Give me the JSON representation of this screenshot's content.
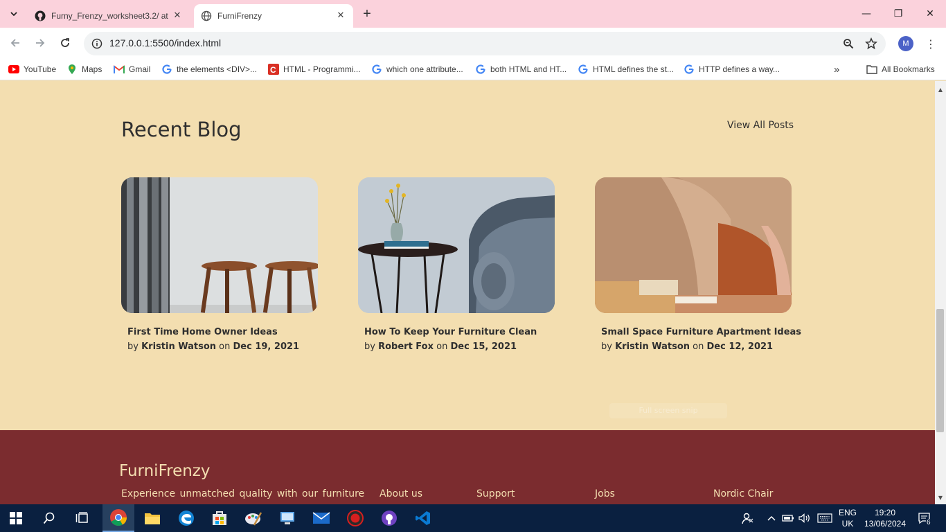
{
  "browser": {
    "tabs": [
      {
        "title": "Furny_Frenzy_worksheet3.2/ at",
        "close": "✕",
        "favicon": "github-icon"
      },
      {
        "title": "FurniFrenzy",
        "close": "✕",
        "favicon": "globe-icon"
      }
    ],
    "new_tab": "+",
    "window": {
      "minimize": "—",
      "restore": "❐",
      "close": "✕"
    },
    "url": "127.0.0.1:5500/index.html",
    "profile_initial": "M",
    "bookmarks": [
      {
        "label": "YouTube",
        "icon": "youtube-icon"
      },
      {
        "label": "Maps",
        "icon": "maps-icon"
      },
      {
        "label": "Gmail",
        "icon": "gmail-icon"
      },
      {
        "label": "the elements <DIV>...",
        "icon": "google-icon"
      },
      {
        "label": "HTML - Programmi...",
        "icon": "c-icon"
      },
      {
        "label": "which one attribute...",
        "icon": "google-icon"
      },
      {
        "label": "both HTML and HT...",
        "icon": "google-icon"
      },
      {
        "label": "HTML defines the st...",
        "icon": "google-icon"
      },
      {
        "label": "HTTP defines a way...",
        "icon": "google-icon"
      }
    ],
    "more_bookmarks": "»",
    "all_bookmarks": "All Bookmarks"
  },
  "blog": {
    "title": "Recent Blog",
    "view_all": "View All Posts",
    "posts": [
      {
        "title": "First Time Home Owner Ideas",
        "by": "by",
        "author": "Kristin Watson",
        "on": "on",
        "date": "Dec 19, 2021"
      },
      {
        "title": "How To Keep Your Furniture Clean",
        "by": "by",
        "author": "Robert Fox",
        "on": "on",
        "date": "Dec 15, 2021"
      },
      {
        "title": "Small Space Furniture Apartment Ideas",
        "by": "by",
        "author": "Kristin Watson",
        "on": "on",
        "date": "Dec 12, 2021"
      }
    ],
    "overlay_hint": "Full screen snip"
  },
  "footer": {
    "brand": "FurniFrenzy",
    "tagline": "Experience unmatched quality with our furniture",
    "links": [
      "About us",
      "Support",
      "Jobs",
      "Nordic Chair"
    ]
  },
  "taskbar": {
    "lang": "ENG",
    "region": "UK",
    "time": "19:20",
    "date": "13/06/2024",
    "notifications": "6"
  },
  "colors": {
    "page_bg": "#f3deb0",
    "footer_bg": "#7b2c2f",
    "footer_text": "#f3deb0",
    "tab_strip": "#fbd2dc"
  }
}
